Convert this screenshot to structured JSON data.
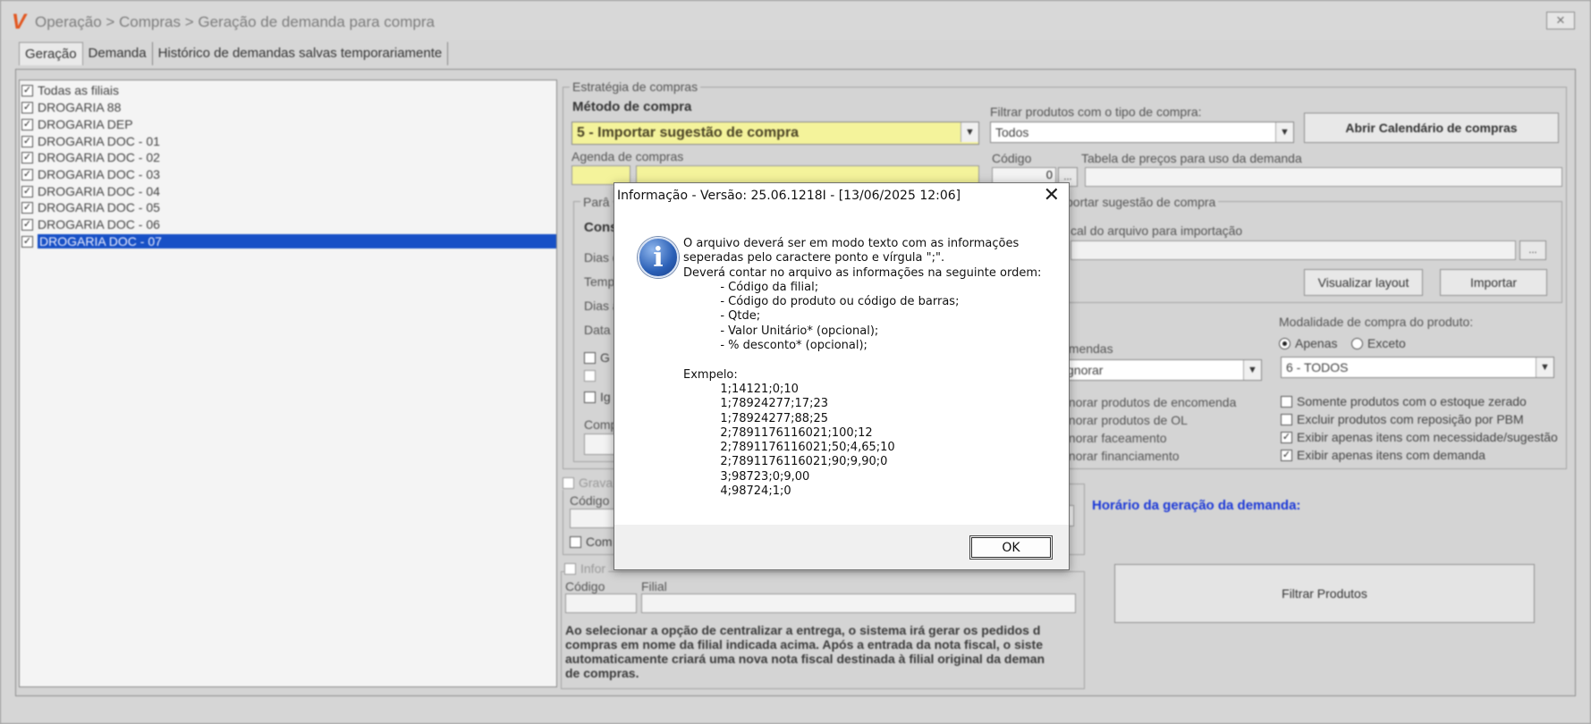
{
  "window": {
    "title": "Operação > Compras > Geração de demanda para compra",
    "logo": "V"
  },
  "tabs": [
    "Geração",
    "Demanda",
    "Histórico de demandas salvas temporariamente"
  ],
  "branches": {
    "all_label": "Todas as filiais",
    "items": [
      {
        "label": "DROGARIA 88",
        "checked": true
      },
      {
        "label": "DROGARIA DEP",
        "checked": true
      },
      {
        "label": "DROGARIA DOC - 01",
        "checked": true
      },
      {
        "label": "DROGARIA DOC - 02",
        "checked": true
      },
      {
        "label": "DROGARIA DOC - 03",
        "checked": true
      },
      {
        "label": "DROGARIA DOC - 04",
        "checked": true
      },
      {
        "label": "DROGARIA DOC - 05",
        "checked": true
      },
      {
        "label": "DROGARIA DOC - 06",
        "checked": true
      },
      {
        "label": "DROGARIA DOC - 07",
        "checked": true,
        "selected": true
      }
    ]
  },
  "strategy": {
    "group_title": "Estratégia de compras",
    "method_label": "Método de compra",
    "method_value": "5 - Importar sugestão de compra",
    "filter_label": "Filtrar produtos com o tipo de compra:",
    "filter_value": "Todos",
    "calendar_button": "Abrir Calendário de compras",
    "agenda_label": "Agenda de compras",
    "code_label": "Código",
    "code_value": "0",
    "code_browse": "...",
    "price_table_label": "Tabela de preços para uso da demanda"
  },
  "params": {
    "group_title": "Parâ",
    "cons": "Cons",
    "dias1": "Dias c",
    "temp": "Temp",
    "dias2": "Dias a",
    "data": "Data",
    "g": "G",
    "i": "Ig",
    "comp": "Comp"
  },
  "import_group": {
    "title": "portar sugestão de compra",
    "file_label": "cal do arquivo para importação",
    "browse": "...",
    "visualizar": "Visualizar layout",
    "importar": "Importar"
  },
  "orders": {
    "label": "omendas",
    "value": "gnorar",
    "checks": [
      "gnorar produtos de encomenda",
      "gnorar produtos de OL",
      "gnorar faceamento",
      "gnorar financiamento"
    ]
  },
  "modality": {
    "label": "Modalidade de compra do produto:",
    "opt_apenas": "Apenas",
    "opt_exceto": "Exceto",
    "value": "6 - TODOS",
    "checks": [
      {
        "label": "Somente produtos com o estoque zerado",
        "checked": false
      },
      {
        "label": "Excluir produtos com reposição por PBM",
        "checked": false
      },
      {
        "label": "Exibir apenas itens com necessidade/sugestão",
        "checked": true
      },
      {
        "label": "Exibir apenas itens com demanda",
        "checked": true
      }
    ]
  },
  "save_group": {
    "grav": "Grava",
    "code_label": "Código",
    "com": "Com"
  },
  "generation_time_label": "Horário da geração da demanda:",
  "central": {
    "label": "Infor",
    "code_label": "Código",
    "branch_label": "Filial",
    "note": "Ao selecionar a opção de centralizar a entrega, o sistema irá gerar os pedidos d\ncompras em nome da filial indicada acima. Após a entrada da nota fiscal, o siste\nautomaticamente criará uma nova nota fiscal destinada à filial original da deman\nde compras."
  },
  "filter_button": "Filtrar Produtos",
  "dialog": {
    "title": "Informação - Versão: 25.06.1218I - [13/06/2025 12:06]",
    "close": "✕",
    "message": "O arquivo deverá ser em modo texto com as informações\nseperadas pelo caractere ponto e vírgula \";\".\nDeverá contar no arquivo as informações na seguinte ordem:\n          - Código da filial;\n          - Código do produto ou código de barras;\n          - Qtde;\n          - Valor Unitário* (opcional);\n          - % desconto* (opcional);\n\nExmpelo:\n          1;14121;0;10\n          1;78924277;17;23\n          1;78924277;88;25\n          2;7891176116021;100;12\n          2;7891176116021;50;4,65;10\n          2;7891176116021;90;9,90;0\n          3;98723;0;9,00\n          4;98724;1;0",
    "ok": "OK"
  }
}
